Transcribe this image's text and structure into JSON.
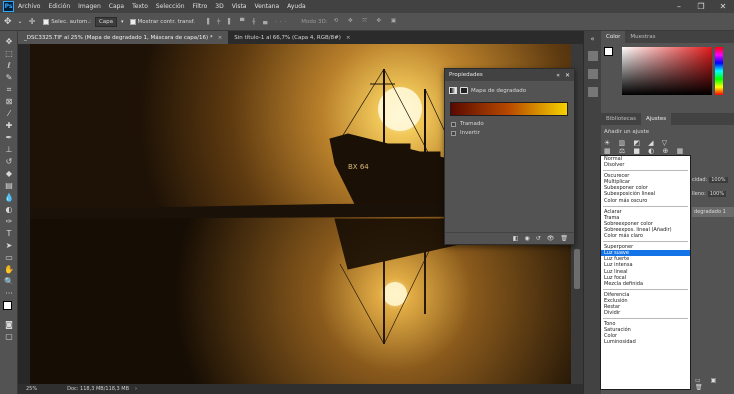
{
  "menubar": {
    "logo": "Ps",
    "items": [
      "Archivo",
      "Edición",
      "Imagen",
      "Capa",
      "Texto",
      "Selección",
      "Filtro",
      "3D",
      "Vista",
      "Ventana",
      "Ayuda"
    ]
  },
  "options_bar": {
    "auto_select_label": "Selec. autom.:",
    "auto_select_value": "Capa",
    "show_transform_label": "Mostrar contr. transf.",
    "mode_3d": "Modo 3D:"
  },
  "tabs": [
    {
      "label": "_DSC3325.TIF al 25% (Mapa de degradado 1, Máscara de capa/16) *",
      "close": "×"
    },
    {
      "label": "Sin título-1 al 66,7% (Capa 4, RGB/8#)",
      "close": "×"
    }
  ],
  "status": {
    "zoom": "25%",
    "doc": "Doc: 118,3 MB/118,3 MB"
  },
  "properties_panel": {
    "title": "Propiedades",
    "subtitle": "Mapa de degradado",
    "gradient": [
      "#5a0a00",
      "#b84a00",
      "#f5d200"
    ],
    "checkbox_dither": "Tramado",
    "checkbox_reverse": "Invertir"
  },
  "color_panel": {
    "tabs": [
      "Color",
      "Muestras"
    ]
  },
  "adjustments_panel": {
    "tabs": [
      "Bibliotecas",
      "Ajustes"
    ],
    "add_label": "Añadir un ajuste"
  },
  "layers_panel": {
    "opacity_label": "cidad:",
    "opacity_value": "100%",
    "fill_label": "lleno:",
    "fill_value": "100%",
    "layer_name": "degradado 1"
  },
  "blend_modes": [
    [
      "Normal",
      "Disolver"
    ],
    [
      "Oscurecer",
      "Multiplicar",
      "Subexponer color",
      "Subexposición lineal",
      "Color más oscuro"
    ],
    [
      "Aclarar",
      "Trama",
      "Sobreexponer color",
      "Sobreexpos. lineal (Añadir)",
      "Color más claro"
    ],
    [
      "Superponer",
      "Luz suave",
      "Luz fuerte",
      "Luz intensa",
      "Luz lineal",
      "Luz focal",
      "Mezcla definida"
    ],
    [
      "Diferencia",
      "Exclusión",
      "Restar",
      "Dividir"
    ],
    [
      "Tono",
      "Saturación",
      "Color",
      "Luminosidad"
    ]
  ],
  "blend_selected": "Luz suave",
  "ship_hull_text": "BX 64"
}
